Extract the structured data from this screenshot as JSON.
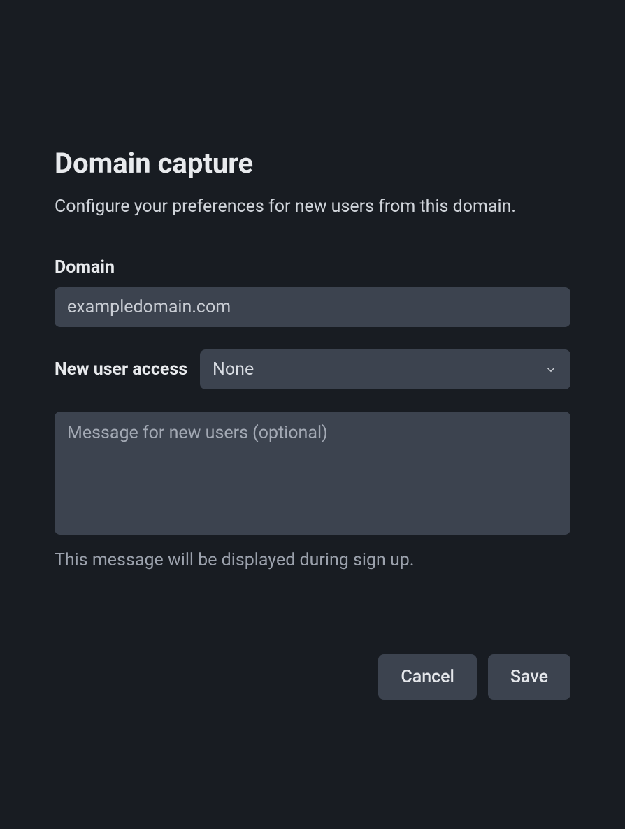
{
  "header": {
    "title": "Domain capture",
    "subtitle": "Configure your preferences for new users from this domain."
  },
  "form": {
    "domain_label": "Domain",
    "domain_value": "exampledomain.com",
    "access_label": "New user access",
    "access_value": "None",
    "message_placeholder": "Message for new users (optional)",
    "message_value": "",
    "helper_text": "This message will be displayed during sign up."
  },
  "buttons": {
    "cancel": "Cancel",
    "save": "Save"
  }
}
